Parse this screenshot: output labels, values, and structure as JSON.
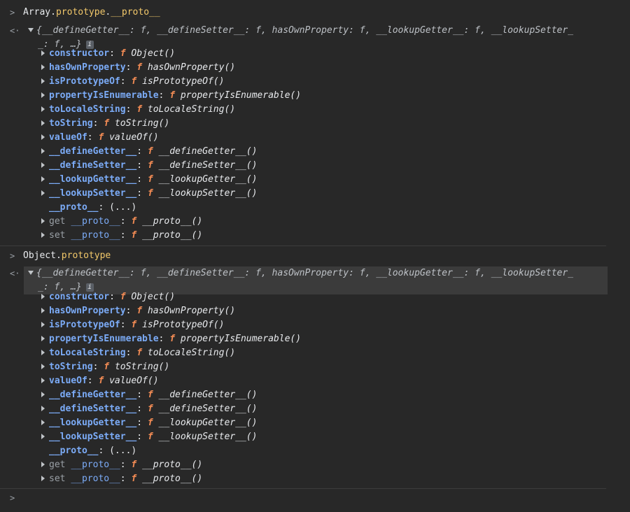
{
  "commands": [
    {
      "object": "Array",
      "dot1": ".",
      "prop1": "prototype",
      "dot2": ".",
      "prop2": "__proto__",
      "summary_line1": "{__defineGetter__: f, __defineSetter__: f, hasOwnProperty: f, __lookupGetter__: f, __lookupSetter_",
      "summary_line2": "_: f, …}",
      "info_label": "i",
      "rows": [
        {
          "key": "constructor",
          "fn": "Object()"
        },
        {
          "key": "hasOwnProperty",
          "fn": "hasOwnProperty()"
        },
        {
          "key": "isPrototypeOf",
          "fn": "isPrototypeOf()"
        },
        {
          "key": "propertyIsEnumerable",
          "fn": "propertyIsEnumerable()"
        },
        {
          "key": "toLocaleString",
          "fn": "toLocaleString()"
        },
        {
          "key": "toString",
          "fn": "toString()"
        },
        {
          "key": "valueOf",
          "fn": "valueOf()"
        },
        {
          "key": "__defineGetter__",
          "fn": "__defineGetter__()"
        },
        {
          "key": "__defineSetter__",
          "fn": "__defineSetter__()"
        },
        {
          "key": "__lookupGetter__",
          "fn": "__lookupGetter__()"
        },
        {
          "key": "__lookupSetter__",
          "fn": "__lookupSetter__()"
        }
      ],
      "proto_key": "__proto__",
      "proto_value": "(...)",
      "getter": {
        "kw": "get",
        "key": "__proto__",
        "fn": "__proto__()"
      },
      "setter": {
        "kw": "set",
        "key": "__proto__",
        "fn": "__proto__()"
      }
    },
    {
      "object": "Object",
      "dot1": ".",
      "prop1": "prototype",
      "dot2": "",
      "prop2": "",
      "summary_line1": "{__defineGetter__: f, __defineSetter__: f, hasOwnProperty: f, __lookupGetter__: f, __lookupSetter_",
      "summary_line2": "_: f, …}",
      "info_label": "i",
      "rows": [
        {
          "key": "constructor",
          "fn": "Object()"
        },
        {
          "key": "hasOwnProperty",
          "fn": "hasOwnProperty()"
        },
        {
          "key": "isPrototypeOf",
          "fn": "isPrototypeOf()"
        },
        {
          "key": "propertyIsEnumerable",
          "fn": "propertyIsEnumerable()"
        },
        {
          "key": "toLocaleString",
          "fn": "toLocaleString()"
        },
        {
          "key": "toString",
          "fn": "toString()"
        },
        {
          "key": "valueOf",
          "fn": "valueOf()"
        },
        {
          "key": "__defineGetter__",
          "fn": "__defineGetter__()"
        },
        {
          "key": "__defineSetter__",
          "fn": "__defineSetter__()"
        },
        {
          "key": "__lookupGetter__",
          "fn": "__lookupGetter__()"
        },
        {
          "key": "__lookupSetter__",
          "fn": "__lookupSetter__()"
        }
      ],
      "proto_key": "__proto__",
      "proto_value": "(...)",
      "getter": {
        "kw": "get",
        "key": "__proto__",
        "fn": "__proto__()"
      },
      "setter": {
        "kw": "set",
        "key": "__proto__",
        "fn": "__proto__()"
      }
    }
  ],
  "glyphs": {
    "prompt": ">",
    "result": "<·",
    "function": "f",
    "colon": ": "
  },
  "colors": {
    "background": "#282828",
    "key": "#7cacf8",
    "function_glyph": "#f28b54",
    "prototype_prop": "#f2c86a"
  }
}
